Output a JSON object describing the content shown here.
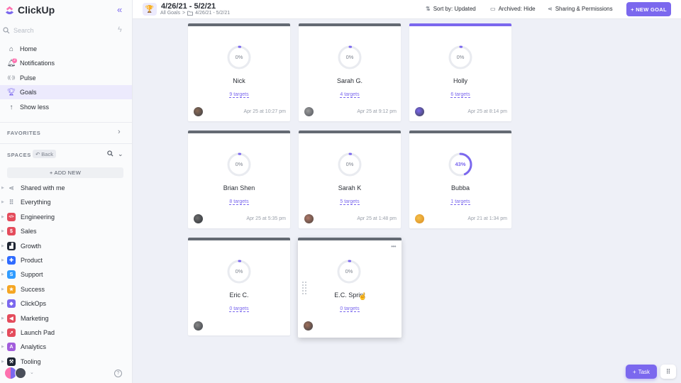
{
  "brand": {
    "name": "ClickUp"
  },
  "sidebar": {
    "search_placeholder": "Search",
    "nav": [
      {
        "label": "Home",
        "icon": "home-icon"
      },
      {
        "label": "Notifications",
        "icon": "bell-icon",
        "badge": "2"
      },
      {
        "label": "Pulse",
        "icon": "pulse-icon"
      },
      {
        "label": "Goals",
        "icon": "trophy-icon",
        "active": true
      },
      {
        "label": "Show less",
        "icon": "arrow-up-icon"
      }
    ],
    "favorites_label": "FAVORITES",
    "spaces_label": "SPACES",
    "back_label": "Back",
    "add_new_label": "+ ADD NEW",
    "spaces": [
      {
        "label": "Shared with me",
        "icon": "share-icon",
        "color": "#9aa0aa"
      },
      {
        "label": "Everything",
        "icon": "grid-icon",
        "color": "#9aa0aa"
      },
      {
        "label": "Engineering",
        "icon": "code-icon",
        "color": "#e44c5c"
      },
      {
        "label": "Sales",
        "icon": "dollar-icon",
        "color": "#e44c5c"
      },
      {
        "label": "Growth",
        "icon": "chart-icon",
        "color": "#1e2533"
      },
      {
        "label": "Product",
        "icon": "puzzle-icon",
        "color": "#2f6bff"
      },
      {
        "label": "Support",
        "icon": "support-icon",
        "color": "#2f9bff"
      },
      {
        "label": "Success",
        "icon": "star-icon",
        "color": "#f5a623"
      },
      {
        "label": "ClickOps",
        "icon": "clickops-icon",
        "color": "#7b68ee"
      },
      {
        "label": "Marketing",
        "icon": "megaphone-icon",
        "color": "#e44c5c"
      },
      {
        "label": "Launch Pad",
        "icon": "rocket-icon",
        "color": "#e44c5c"
      },
      {
        "label": "Analytics",
        "icon": "analytics-icon",
        "color": "#a25ddc"
      },
      {
        "label": "Tooling",
        "icon": "tool-icon",
        "color": "#1e2533"
      }
    ]
  },
  "header": {
    "title": "4/26/21 - 5/2/21",
    "crumb_root": "All Goals",
    "crumb_sep": ">",
    "crumb_folder": "4/26/21 - 5/2/21",
    "sort_label": "Sort by: Updated",
    "archived_label": "Archived: Hide",
    "sharing_label": "Sharing & Permissions",
    "new_goal_label": "+ NEW GOAL"
  },
  "goals": [
    {
      "name": "Nick",
      "percent": "0%",
      "progress": 0,
      "targets": "9 targets",
      "updated": "Apr 25 at 10:27 pm",
      "accent": false
    },
    {
      "name": "Sarah G.",
      "percent": "0%",
      "progress": 0,
      "targets": "4 targets",
      "updated": "Apr 25 at 9:12 pm",
      "accent": false
    },
    {
      "name": "Holly",
      "percent": "0%",
      "progress": 0,
      "targets": "6 targets",
      "updated": "Apr 25 at 8:14 pm",
      "accent": true
    },
    {
      "name": "Brian Shen",
      "percent": "0%",
      "progress": 0,
      "targets": "8 targets",
      "updated": "Apr 25 at 5:35 pm",
      "accent": false
    },
    {
      "name": "Sarah K",
      "percent": "0%",
      "progress": 0,
      "targets": "5 targets",
      "updated": "Apr 25 at 1:48 pm",
      "accent": false
    },
    {
      "name": "Bubba",
      "percent": "43%",
      "progress": 0.43,
      "targets": "1 targets",
      "updated": "Apr 21 at 1:34 pm",
      "accent": false
    },
    {
      "name": "Eric C.",
      "percent": "0%",
      "progress": 0,
      "targets": "0 targets",
      "updated": "",
      "accent": false
    },
    {
      "name": "E.C. Sprint",
      "percent": "0%",
      "progress": 0,
      "targets": "0 targets",
      "updated": "",
      "accent": false,
      "menu": "•••"
    }
  ],
  "fab": {
    "task_label": "Task"
  },
  "colors": {
    "accent": "#7b68ee",
    "ring_track": "#e9ebf0"
  }
}
